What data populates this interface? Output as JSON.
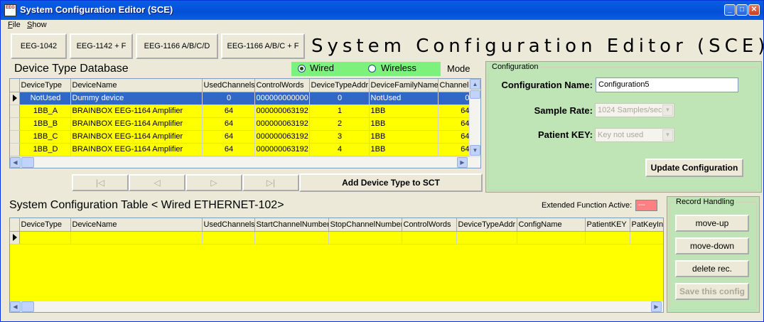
{
  "window": {
    "title": "System Configuration Editor (SCE)",
    "icon_text": "EEG",
    "controls": [
      "minimize-icon",
      "maximize-icon",
      "close-icon"
    ]
  },
  "menu": {
    "file": "File",
    "show": "Show"
  },
  "device_buttons": [
    {
      "label": "EEG-1042"
    },
    {
      "label": "EEG-1142 + F"
    },
    {
      "label": "EEG-1166 A/B/C/D"
    },
    {
      "label": "EEG-1166 A/B/C + F"
    }
  ],
  "big_title": "System Configuration Editor (SCE)",
  "device_db": {
    "title": "Device Type Database",
    "mode": {
      "wired": "Wired",
      "wireless": "Wireless",
      "label": "Mode",
      "selected": "Wired"
    },
    "columns": [
      "DeviceType",
      "DeviceName",
      "UsedChannels",
      "ControlWords",
      "DeviceTypeAddr",
      "DeviceFamilyName",
      "Channels"
    ],
    "rows": [
      [
        "NotUsed",
        "Dummy device",
        "0",
        "000000000000",
        "0",
        "NotUsed",
        "0"
      ],
      [
        "1BB_A",
        "BRAINBOX EEG-1164 Amplifier",
        "64",
        "000000063192",
        "1",
        "1BB",
        "64"
      ],
      [
        "1BB_B",
        "BRAINBOX EEG-1164 Amplifier",
        "64",
        "000000063192",
        "2",
        "1BB",
        "64"
      ],
      [
        "1BB_C",
        "BRAINBOX EEG-1164 Amplifier",
        "64",
        "000000063192",
        "3",
        "1BB",
        "64"
      ],
      [
        "1BB_D",
        "BRAINBOX EEG-1164 Amplifier",
        "64",
        "000000063192",
        "4",
        "1BB",
        "64"
      ]
    ]
  },
  "nav": {
    "first": "|◁",
    "prev": "◁",
    "next": "▷",
    "last": "▷|"
  },
  "add_device_button": "Add Device Type to SCT",
  "configuration": {
    "legend": "Configuration",
    "name_label": "Configuration Name:",
    "name_value": "Configuration5",
    "sample_rate_label": "Sample Rate:",
    "sample_rate_value": "1024 Samples/sec",
    "patient_key_label": "Patient KEY:",
    "patient_key_value": "Key not used",
    "update_button": "Update Configuration"
  },
  "sct": {
    "title": "System Configuration Table < Wired ETHERNET-102>",
    "extended_label": "Extended Function Active:",
    "extended_value": "---",
    "columns": [
      "DeviceType",
      "DeviceName",
      "UsedChannels",
      "StartChannelNumber",
      "StopChannelNumber",
      "ControlWords",
      "DeviceTypeAddr",
      "ConfigName",
      "PatientKEY",
      "PatKeyIn"
    ]
  },
  "record_handling": {
    "legend": "Record Handling",
    "move_up": "move-up",
    "move_down": "move-down",
    "delete": "delete rec.",
    "save": "Save this config"
  },
  "colors": {
    "title_bar": "#0554dc",
    "mode_green": "#7cf27c",
    "panel_green": "#bfe5b7",
    "row_yellow": "#ffff00",
    "row_selected": "#3168c6",
    "extended_indicator": "#ff8080"
  }
}
